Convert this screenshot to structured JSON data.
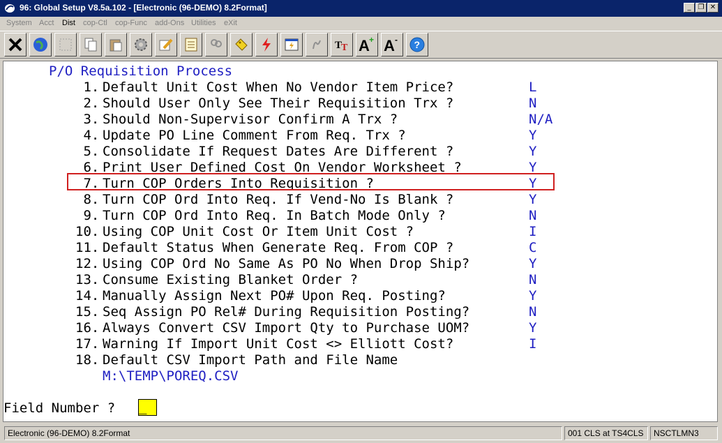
{
  "window": {
    "title": "96: Global Setup V8.5a.102 - [Electronic (96-DEMO) 8.2Format]",
    "minimize": "_",
    "restore": "❐",
    "close": "✕"
  },
  "menu": [
    {
      "label": "System"
    },
    {
      "label": "Acct"
    },
    {
      "label": "Dist"
    },
    {
      "label": "cop-Ctl"
    },
    {
      "label": "cop-Func"
    },
    {
      "label": "add-Ons"
    },
    {
      "label": "Utilities"
    },
    {
      "label": "eXit"
    }
  ],
  "toolbar": [
    {
      "icon": "close-x-icon"
    },
    {
      "icon": "globe-icon"
    },
    {
      "icon": "blank-icon"
    },
    {
      "icon": "copy-icon"
    },
    {
      "icon": "paste-icon"
    },
    {
      "icon": "gear-icon"
    },
    {
      "icon": "edit-pencil-icon"
    },
    {
      "icon": "notepad-icon"
    },
    {
      "icon": "users-icon"
    },
    {
      "icon": "tag-icon"
    },
    {
      "icon": "lightning-icon"
    },
    {
      "icon": "window-lightning-icon"
    },
    {
      "icon": "script-icon"
    },
    {
      "icon": "font-tt-icon"
    },
    {
      "icon": "font-increase-icon",
      "glyph": "A",
      "mod": "+"
    },
    {
      "icon": "font-decrease-icon",
      "glyph": "A",
      "mod": "-"
    },
    {
      "icon": "help-icon",
      "glyph": "?"
    }
  ],
  "screen": {
    "heading": "P/O Requisition Process",
    "items": [
      {
        "num": " 1.",
        "question": "Default Unit Cost When No Vendor Item Price?",
        "answer": "L"
      },
      {
        "num": " 2.",
        "question": "Should User Only See Their Requisition Trx ?",
        "answer": "N"
      },
      {
        "num": " 3.",
        "question": "Should Non-Supervisor Confirm A Trx ?",
        "answer": "N/A"
      },
      {
        "num": " 4.",
        "question": "Update PO Line Comment From Req. Trx ?",
        "answer": "Y"
      },
      {
        "num": " 5.",
        "question": "Consolidate If Request Dates Are Different ?",
        "answer": "Y"
      },
      {
        "num": " 6.",
        "question": "Print User Defined Cost On Vendor Worksheet ?",
        "answer": "Y"
      },
      {
        "num": " 7.",
        "question": "Turn COP Orders Into Requisition ?",
        "answer": "Y"
      },
      {
        "num": " 8.",
        "question": "Turn COP Ord Into Req. If Vend-No Is Blank ?",
        "answer": "Y"
      },
      {
        "num": " 9.",
        "question": "Turn COP Ord Into Req. In Batch Mode Only ?",
        "answer": "N"
      },
      {
        "num": "10.",
        "question": "Using COP Unit Cost Or Item Unit Cost ?",
        "answer": "I"
      },
      {
        "num": "11.",
        "question": "Default Status When Generate Req. From COP ?",
        "answer": "C"
      },
      {
        "num": "12.",
        "question": "Using COP Ord No Same As PO No When Drop Ship?",
        "answer": "Y"
      },
      {
        "num": "13.",
        "question": "Consume Existing Blanket Order ?",
        "answer": "N"
      },
      {
        "num": "14.",
        "question": "Manually Assign Next PO# Upon Req. Posting?",
        "answer": "Y"
      },
      {
        "num": "15.",
        "question": "Seq Assign PO Rel# During Requisition Posting?",
        "answer": "N"
      },
      {
        "num": "16.",
        "question": "Always Convert CSV Import Qty to Purchase UOM?",
        "answer": "Y"
      },
      {
        "num": "17.",
        "question": "Warning If Import Unit Cost <> Elliott Cost?",
        "answer": "I"
      },
      {
        "num": "18.",
        "question": "Default CSV Import Path and File Name",
        "answer": ""
      }
    ],
    "path_value": "M:\\TEMP\\POREQ.CSV",
    "prompt": "Field Number ?",
    "cursor": "_"
  },
  "status": {
    "left": "Electronic (96-DEMO) 8.2Format",
    "mid": "001 CLS at TS4CLS",
    "right": "NSCTLMN3"
  },
  "colors": {
    "titlebar": "#0a246a",
    "answer_blue": "#1f1fc2",
    "highlight_red": "#d02020",
    "cursor_yellow": "#ffff00"
  }
}
